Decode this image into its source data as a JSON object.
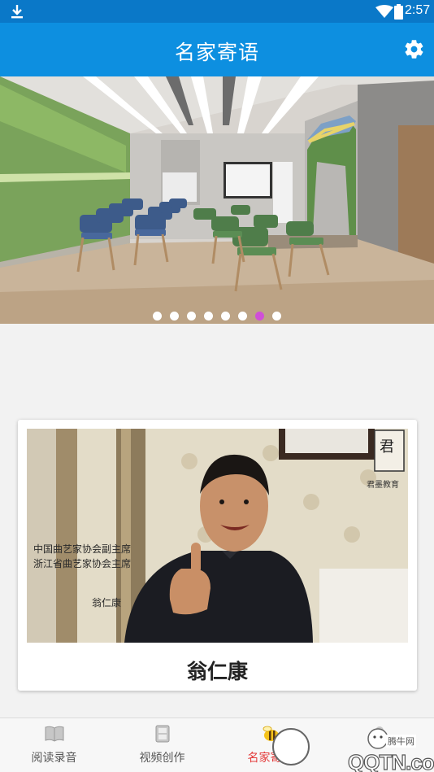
{
  "status_bar": {
    "time": "2:57",
    "download_icon": "download-icon",
    "wifi_icon": "wifi-icon",
    "battery_icon": "battery-icon"
  },
  "app_bar": {
    "title": "名家寄语",
    "settings_icon": "gear-icon"
  },
  "banner": {
    "slide_count": 8,
    "active_index": 6,
    "active_color": "#d04fd8"
  },
  "card": {
    "name": "翁仁康"
  },
  "bottom_nav": {
    "items": [
      {
        "label": "阅读录音",
        "icon": "book-icon",
        "active": false
      },
      {
        "label": "视频创作",
        "icon": "film-icon",
        "active": false
      },
      {
        "label": "名家寄语",
        "icon": "bee-icon",
        "active": true
      },
      {
        "label": "",
        "icon": "person-icon",
        "active": false
      }
    ],
    "active_color": "#e33a3a"
  },
  "watermark": {
    "logo_text": "QQTN.com",
    "cn_text": "腾牛网"
  },
  "colors": {
    "status_bar": "#0a78c8",
    "app_bar": "#0d8fe0",
    "background": "#f2f2f2"
  }
}
